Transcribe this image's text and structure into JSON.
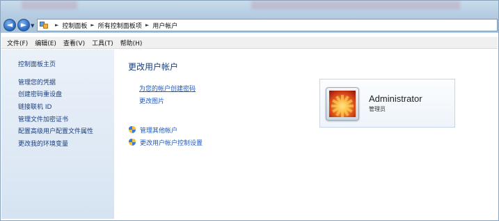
{
  "nav": {
    "back_glyph": "◄",
    "forward_glyph": "►",
    "dropdown_glyph": "▼",
    "breadcrumb": [
      "控制面板",
      "所有控制面板项",
      "用户帐户"
    ]
  },
  "menu": [
    "文件(F)",
    "编辑(E)",
    "查看(V)",
    "工具(T)",
    "帮助(H)"
  ],
  "sidebar": {
    "home": "控制面板主页",
    "links": [
      "管理您的凭据",
      "创建密码重设盘",
      "链接联机 ID",
      "管理文件加密证书",
      "配置高级用户配置文件属性",
      "更改我的环境变量"
    ]
  },
  "main": {
    "heading": "更改用户帐户",
    "links": [
      "为您的帐户创建密码",
      "更改图片"
    ],
    "shield_links": [
      "管理其他帐户",
      "更改用户帐户控制设置"
    ]
  },
  "user": {
    "name": "Administrator",
    "role": "管理员"
  },
  "colors": {
    "link": "#1c5ac6",
    "heading": "#1a3d7a",
    "sidebar_link": "#1a3e80"
  }
}
